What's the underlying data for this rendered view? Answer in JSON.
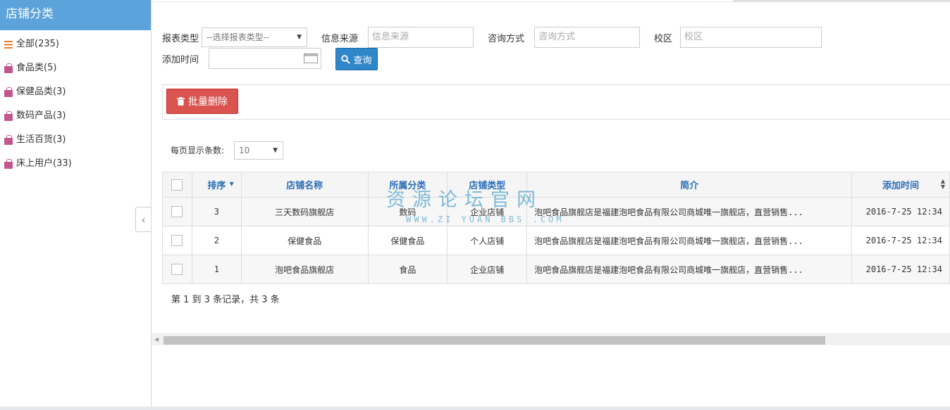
{
  "sidebar": {
    "title": "店铺分类",
    "categories": [
      {
        "label": "全部(235)",
        "icon": "list-icon"
      },
      {
        "label": "食品类(5)",
        "icon": "shopping-bag-icon"
      },
      {
        "label": "保健品类(3)",
        "icon": "shopping-bag-icon"
      },
      {
        "label": "数码产品(3)",
        "icon": "shopping-bag-icon"
      },
      {
        "label": "生活百货(3)",
        "icon": "shopping-bag-icon"
      },
      {
        "label": "床上用户(33)",
        "icon": "shopping-bag-icon"
      }
    ],
    "collapse_glyph": "‹"
  },
  "filters": {
    "report_type_label": "报表类型",
    "report_type_selected": "--选择报表类型--",
    "source_label": "信息来源",
    "source_placeholder": "信息来源",
    "consult_label": "咨询方式",
    "consult_placeholder": "咨询方式",
    "campus_label": "校区",
    "campus_placeholder": "校区",
    "date_label": "添加时间",
    "query_button": "查询"
  },
  "toolbar": {
    "batch_delete_button": "批量删除"
  },
  "page_size": {
    "label": "每页显示条数:",
    "selected": "10"
  },
  "table": {
    "columns": [
      "排序",
      "店铺名称",
      "所属分类",
      "店铺类型",
      "简介",
      "添加时间"
    ],
    "rows": [
      {
        "order": "3",
        "name": "三天数码旗舰店",
        "category": "数码",
        "type": "企业店铺",
        "desc": "泡吧食品旗舰店是福建泡吧食品有限公司商城唯一旗舰店，直营销售...",
        "time": "2016-7-25 12:34"
      },
      {
        "order": "2",
        "name": "保健食品",
        "category": "保健食品",
        "type": "个人店铺",
        "desc": "泡吧食品旗舰店是福建泡吧食品有限公司商城唯一旗舰店，直营销售...",
        "time": "2016-7-25 12:34"
      },
      {
        "order": "1",
        "name": "泡吧食品旗舰店",
        "category": "食品",
        "type": "企业店铺",
        "desc": "泡吧食品旗舰店是福建泡吧食品有限公司商城唯一旗舰店，直营销售...",
        "time": "2016-7-25 12:34"
      }
    ]
  },
  "summary": "第 1 到 3 条记录，共 3 条",
  "watermark": {
    "main": "资源论坛官网",
    "sub": "WWW.ZI YUAN BBS .COM"
  },
  "colors": {
    "sidebar_header": "#5ba3da",
    "query_button": "#2f86c9",
    "delete_button": "#d9534f",
    "header_text": "#2a6fb8"
  }
}
